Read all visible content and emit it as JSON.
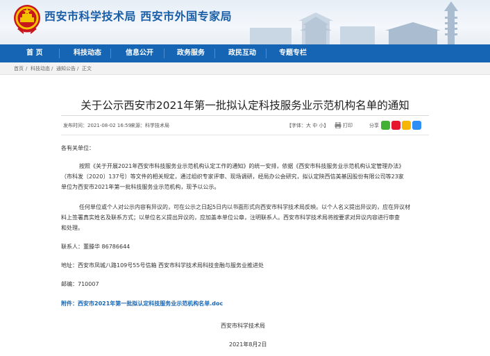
{
  "header": {
    "site_title": "西安市科学技术局 西安市外国专家局",
    "colors": {
      "nav_bg": "#1565b4",
      "title": "#1a5ea8",
      "link": "#1565b4"
    }
  },
  "nav": {
    "items": [
      "首 页",
      "科技动态",
      "信息公开",
      "政务服务",
      "政民互动",
      "专题专栏"
    ]
  },
  "breadcrumb": [
    "首页",
    "科技动态",
    "通知公告",
    "正文"
  ],
  "breadcrumb_separator": "/",
  "article": {
    "title": "关于公示西安市2021年第一批拟认定科技服务业示范机构名单的通知",
    "publish_time": "发布时间：2021-08-02 16:59",
    "source": "来源：科学技术局",
    "font_size_label": "【字体：大 中 小】",
    "print_label": "打印",
    "share_label": "分享",
    "greeting": "各有关单位：",
    "para1_line1": "按照《关于开展2021年西安市科技服务业示范机构认定工作的通知》的统一安排，依据《西安市科技服务业示范机构认定管理办法》",
    "para1_line2": "（市科发〔2020〕137号）等文件的相关规定，通过组织专家评审、现场调研，经局办公会研究，拟认定陕西信美基因股份有限公司等23家",
    "para1_line3": "单位为西安市2021年第一批科技服务业示范机构，现予以公示。",
    "para2_line1": "任何单位或个人对公示内容有异议的，可在公示之日起5日内以书面形式向西安市科学技术局反映。以个人名义提出异议的，应在异议材",
    "para2_line2": "料上签署真实姓名及联系方式；以单位名义提出异议的，应加盖本单位公章，注明联系人。西安市科学技术局将按要求对异议内容进行审查",
    "para2_line3": "和处理。",
    "contact": "联系人：董滕华 86786644",
    "address": "地址：西安市凤城八路109号55号信箱 西安市科学技术局科技金融与服务业推进处",
    "postcode": "邮编：710007",
    "attachment_label": "附件：",
    "attachment_name": "西安市2021年第一批拟认定科技服务业示范机构名单.doc",
    "signature_org": "西安市科学技术局",
    "signature_date": "2021年8月2日"
  },
  "icons": [
    "national-emblem-icon",
    "print-icon",
    "wechat-icon",
    "weibo-icon",
    "qzone-icon",
    "qq-icon"
  ]
}
